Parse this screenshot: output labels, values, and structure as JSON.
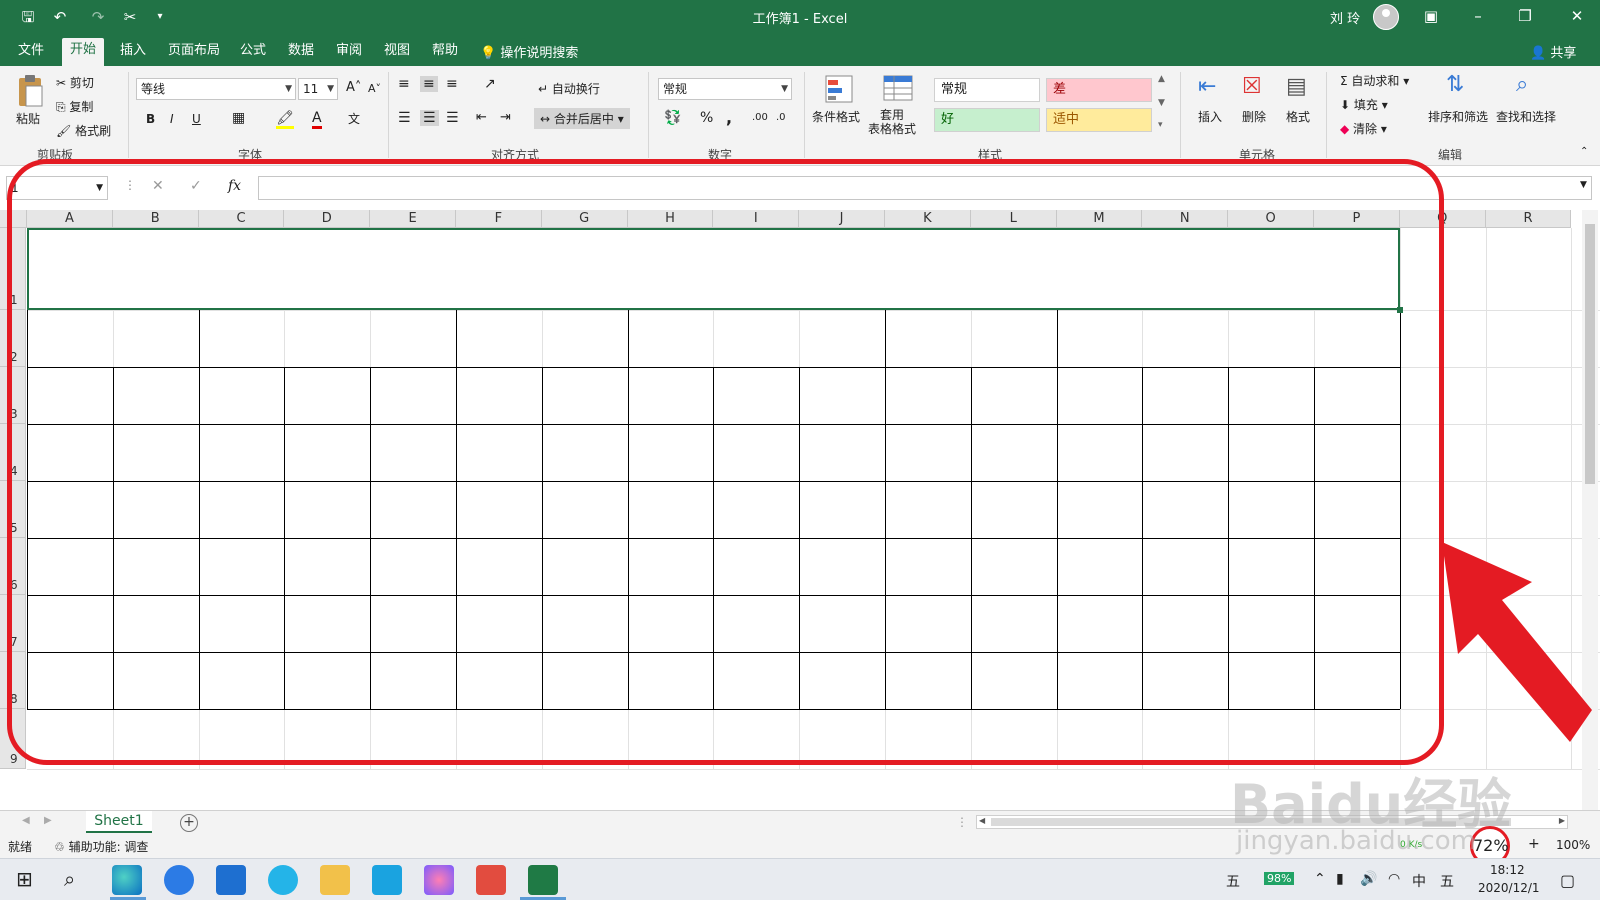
{
  "titlebar": {
    "title": "工作簿1 - Excel",
    "user": "刘 玲"
  },
  "tabs": [
    "文件",
    "开始",
    "插入",
    "页面布局",
    "公式",
    "数据",
    "审阅",
    "视图",
    "帮助"
  ],
  "active_tab": "开始",
  "tell_me": "操作说明搜索",
  "share": "共享",
  "ribbon": {
    "clipboard": {
      "paste": "粘贴",
      "cut": "剪切",
      "copy": "复制",
      "format_painter": "格式刷",
      "label": "剪贴板"
    },
    "font": {
      "name": "等线",
      "size": "11",
      "bold": "B",
      "italic": "I",
      "underline": "U",
      "label": "字体"
    },
    "alignment": {
      "wrap": "自动换行",
      "merge": "合并后居中",
      "label": "对齐方式"
    },
    "number": {
      "format": "常规",
      "percent": "%",
      "comma": ",",
      "label": "数字"
    },
    "styles": {
      "conditional": "条件格式",
      "table_format": "套用\n表格格式",
      "cells": [
        {
          "text": "常规",
          "bg": "#ffffff",
          "fg": "#222222"
        },
        {
          "text": "差",
          "bg": "#ffc7ce",
          "fg": "#9c0006"
        },
        {
          "text": "好",
          "bg": "#c6efce",
          "fg": "#006100"
        },
        {
          "text": "适中",
          "bg": "#ffeb9c",
          "fg": "#9c5700"
        }
      ],
      "label": "样式"
    },
    "cells": {
      "insert": "插入",
      "delete": "删除",
      "format": "格式",
      "label": "单元格"
    },
    "editing": {
      "autosum": "自动求和",
      "fill": "填充",
      "clear": "清除",
      "sort": "排序和筛选",
      "find": "查找和选择",
      "label": "编辑"
    }
  },
  "formula": {
    "namebox": "1",
    "fx": "fx"
  },
  "columns": [
    "A",
    "B",
    "C",
    "D",
    "E",
    "F",
    "G",
    "H",
    "I",
    "J",
    "K",
    "L",
    "M",
    "N",
    "O",
    "P",
    "Q",
    "R"
  ],
  "rows": [
    "1",
    "2",
    "3",
    "4",
    "5",
    "6",
    "7",
    "8",
    "9"
  ],
  "sheet": {
    "name": "Sheet1",
    "add": "+"
  },
  "status": {
    "ready": "就绪",
    "accessibility": "辅助功能: 调查",
    "zoom": "100%",
    "zoom_badge": "72%",
    "net_speed": "0 K/s"
  },
  "taskbar": {
    "time": "18:12",
    "date": "2020/12/1",
    "ime": "中",
    "ime2": "五",
    "battery": "98%"
  },
  "watermark": {
    "brand": "Baidu经验",
    "url": "jingyan.baidu.com"
  },
  "colors": {
    "accent": "#217346",
    "annotation": "#e41b23"
  }
}
